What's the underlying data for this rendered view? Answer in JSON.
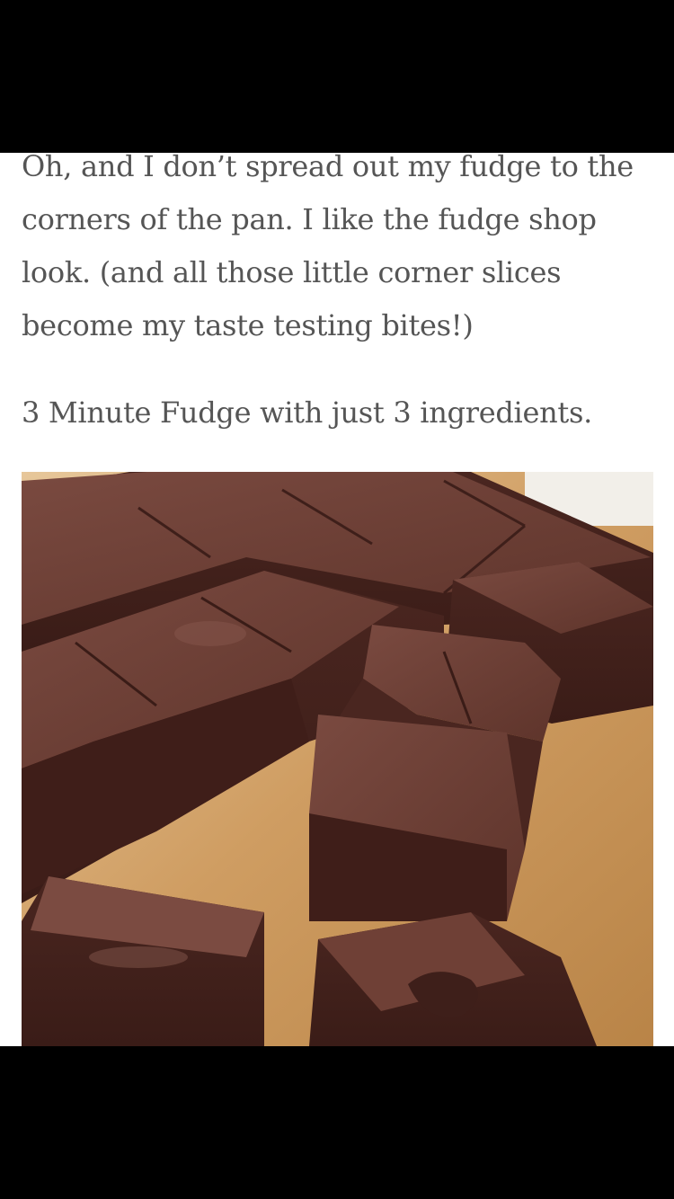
{
  "article": {
    "paragraph_1": "Oh, and I don’t spread out my fudge to the corners of the pan. I like the fudge shop look. (and all those little corner slices become my taste testing bites!)",
    "paragraph_2": "3 Minute Fudge with just 3 ingredients."
  },
  "colors": {
    "background": "#ffffff",
    "text": "#555555",
    "letterbox": "#000000",
    "fudge": "#5a3028",
    "board": "#c9955c"
  },
  "photo": {
    "subject": "fudge-squares-on-wooden-board"
  }
}
